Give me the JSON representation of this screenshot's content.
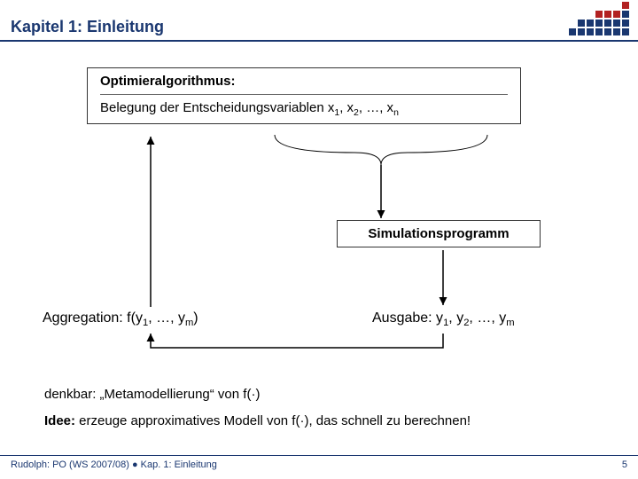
{
  "header": {
    "title": "Kapitel 1: Einleitung"
  },
  "box_opt": {
    "heading": "Optimieralgorithmus:",
    "body_prefix": "Belegung der Entscheidungsvariablen x",
    "s1": "1",
    "sep1": ", x",
    "s2": "2",
    "sep2": ", …, x",
    "sn": "n"
  },
  "box_sim": {
    "label": "Simulationsprogramm"
  },
  "aggregation": {
    "prefix": "Aggregation: f(y",
    "s1": "1",
    "mid": ", …, y",
    "sm": "m",
    "suffix": ")"
  },
  "output": {
    "prefix": "Ausgabe: y",
    "s1": "1",
    "sep1": ", y",
    "s2": "2",
    "sep2": ", …, y",
    "sm": "m"
  },
  "note1": {
    "text": "denkbar: „Metamodellierung“ von f(·)"
  },
  "note2": {
    "label": "Idee:",
    "text": " erzeuge approximatives Modell von f(·), das schnell zu berechnen!"
  },
  "footer": {
    "left": "Rudolph: PO (WS 2007/08) ● Kap. 1: Einleitung",
    "right": "5"
  }
}
